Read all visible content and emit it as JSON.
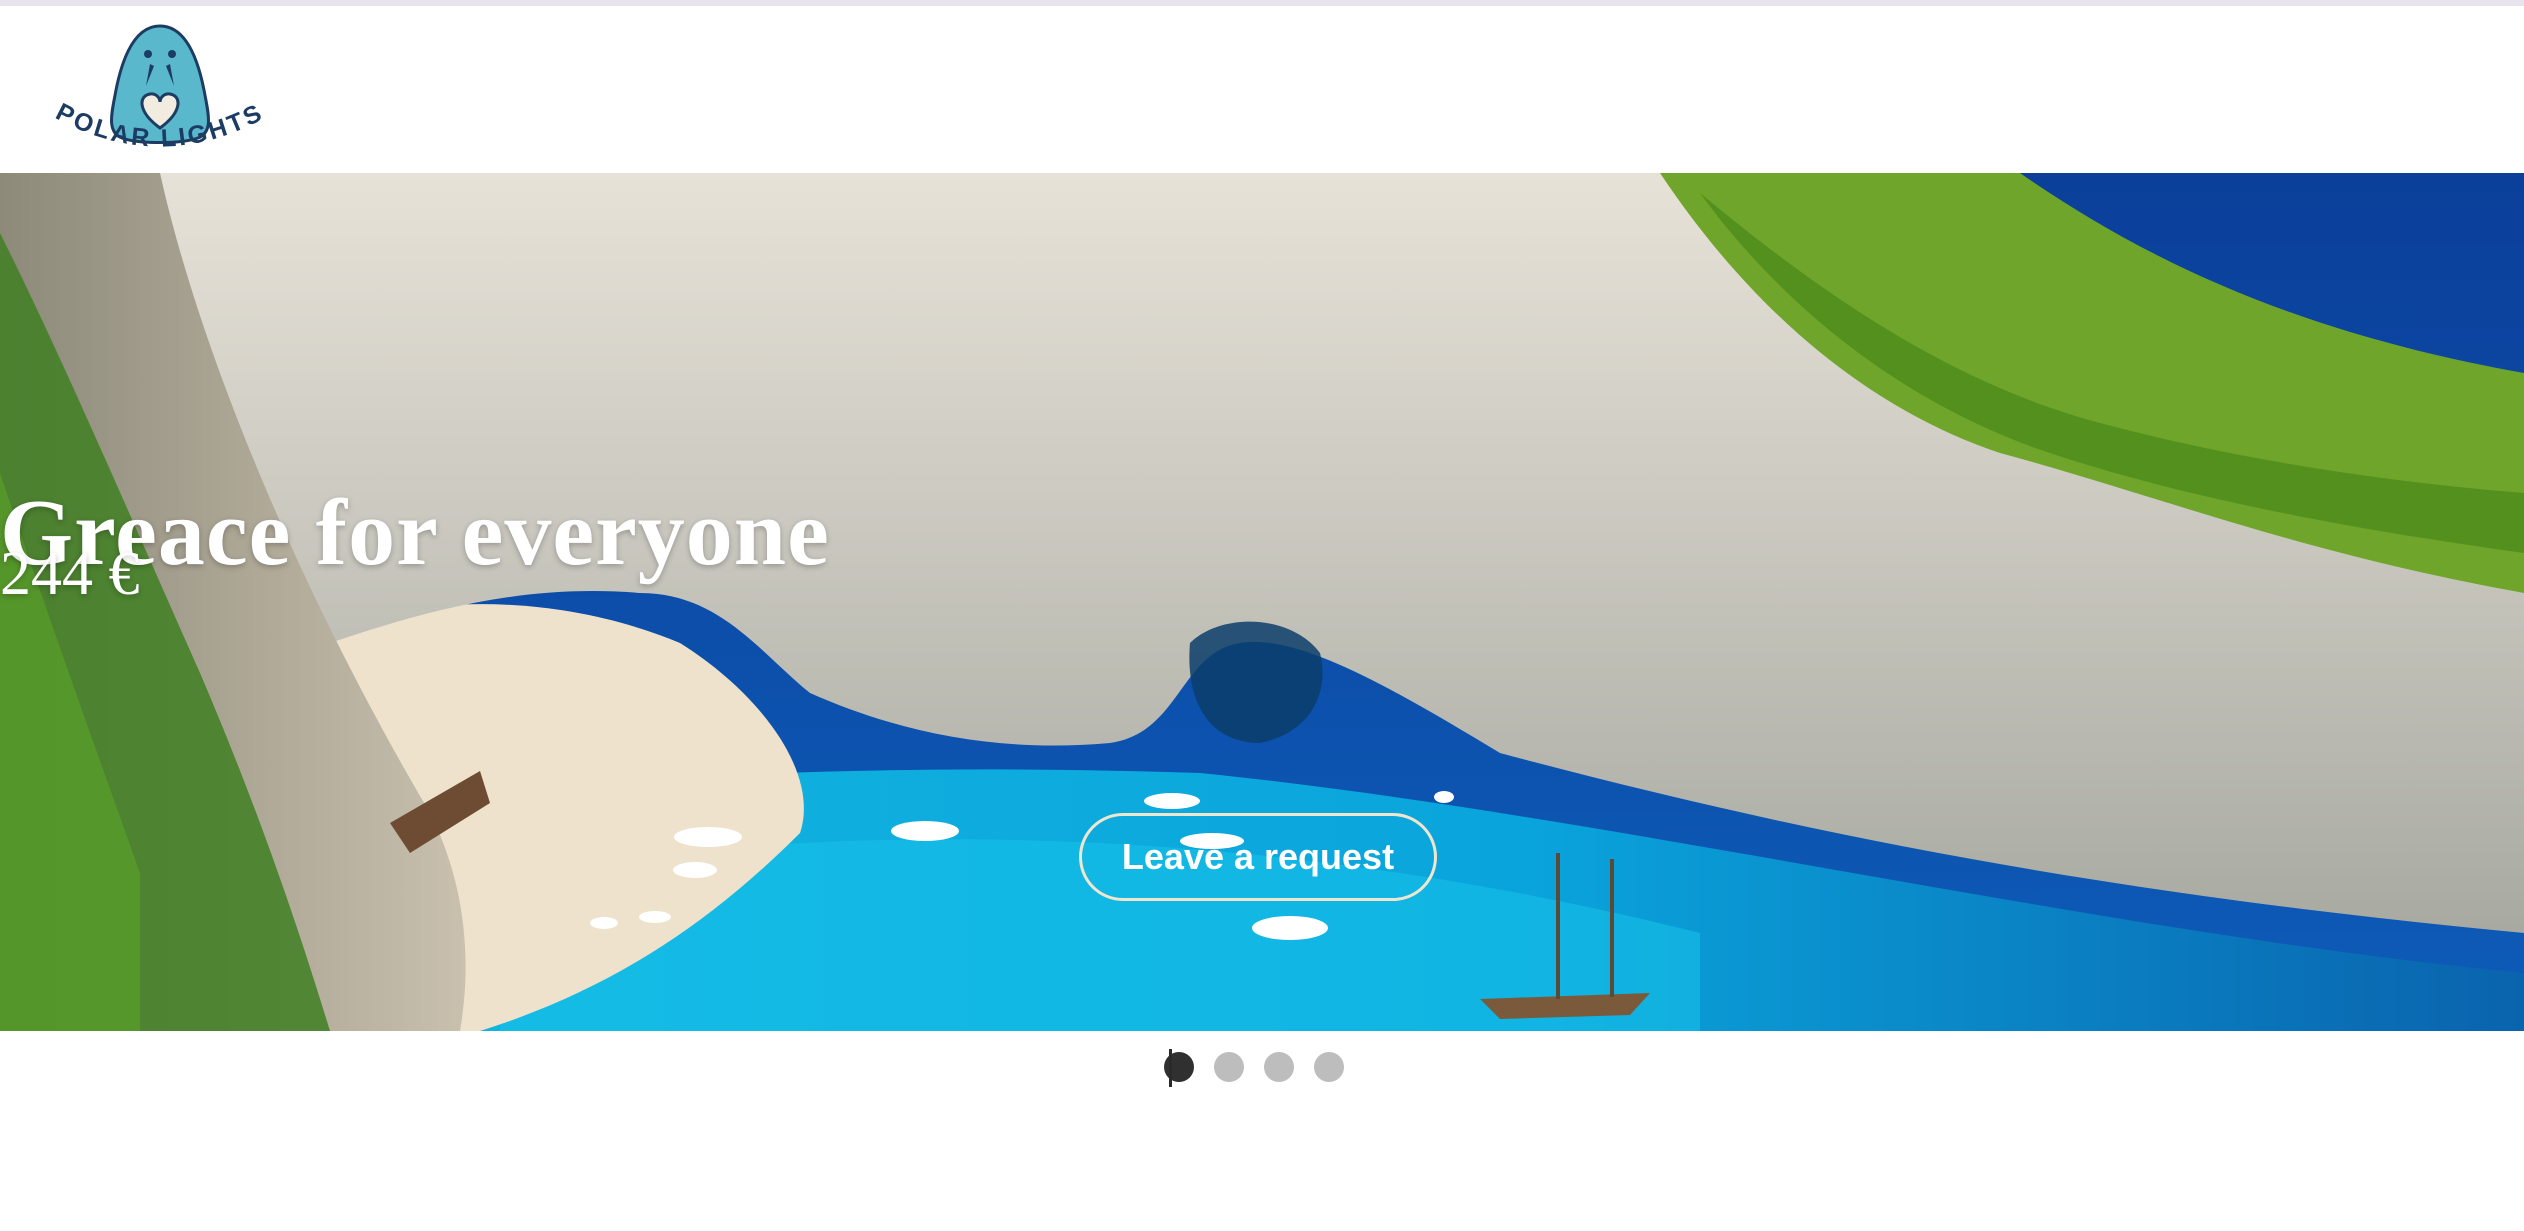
{
  "brand": {
    "logo_text": "POLAR LIGHTS",
    "icon": "walrus-heart-logo",
    "colors": {
      "logo_teal": "#5ab8cc",
      "logo_navy": "#1d3c63",
      "heart_fill": "#f1ecdf"
    }
  },
  "hero": {
    "title": "Greace for everyone",
    "price": "244 €",
    "cta_label": "Leave a request",
    "image": "coastal-cove-beach-photo"
  },
  "slider": {
    "slide_count": 4,
    "active_index": 0,
    "colors": {
      "active": "#303030",
      "inactive": "#bdbdbd"
    }
  }
}
